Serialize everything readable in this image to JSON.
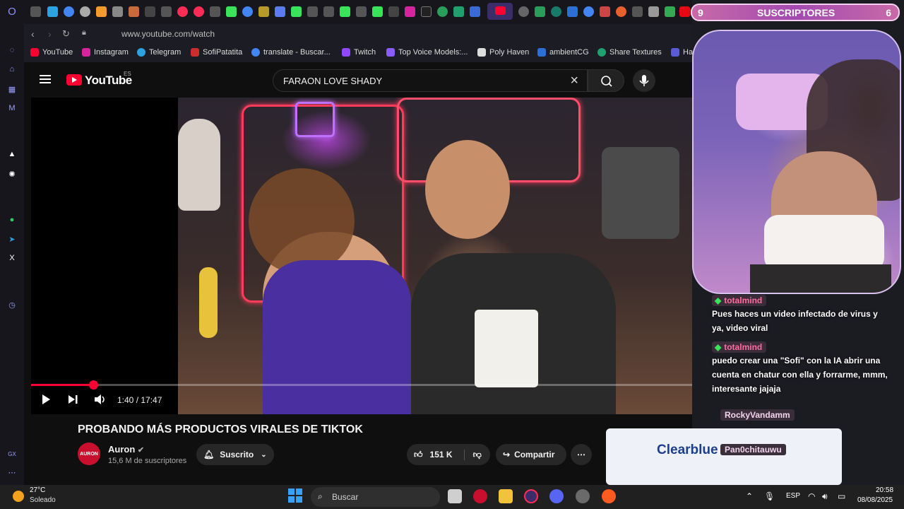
{
  "browser": {
    "url": "www.youtube.com/watch",
    "bookmarks": [
      {
        "label": "YouTube",
        "color": "#ff0033"
      },
      {
        "label": "Instagram",
        "color": "#d6249f"
      },
      {
        "label": "Telegram",
        "color": "#2aa3e0"
      },
      {
        "label": "SofiPatatita",
        "color": "#cc2d2d"
      },
      {
        "label": "translate - Buscar...",
        "color": "#4285f4"
      },
      {
        "label": "Twitch",
        "color": "#9146ff"
      },
      {
        "label": "Top Voice Models:...",
        "color": "#8a5cff"
      },
      {
        "label": "Poly Haven",
        "color": "#dddddd"
      },
      {
        "label": "ambientCG",
        "color": "#2c6fd6"
      },
      {
        "label": "Share Textures",
        "color": "#1fa06e"
      },
      {
        "label": "Har",
        "color": "#5b5bd6"
      }
    ]
  },
  "youtube": {
    "logo_text": "YouTube",
    "country_code": "ES",
    "search_value": "FARAON LOVE SHADY",
    "player": {
      "current_time": "1:40",
      "duration": "17:47",
      "time_label": "1:40 / 17:47",
      "progress_fraction": 0.094
    },
    "video_title": "PROBANDO MÁS PRODUCTOS VIRALES DE TIKTOK",
    "channel": {
      "name": "Auron",
      "avatar_text": "AURON",
      "subscribers": "15,6 M de suscriptores"
    },
    "subscribe_label": "Suscrito",
    "likes": "151 K",
    "share_label": "Compartir",
    "ad_brand": "Clearblue"
  },
  "overlay": {
    "subs_left": "9",
    "subs_title": "SUSCRIPTORES",
    "subs_right": "6",
    "chat": [
      {
        "user": "totalmind",
        "message": "Pues haces un video infectado de virus y ya, video viral"
      },
      {
        "user": "totalmind",
        "message": "puedo crear una \"Sofi\" con la IA abrir una cuenta en chatur con ella y forrarme, mmm, interesante jajaja"
      }
    ],
    "extra_users": [
      "RockyVandamm",
      "Pan0chitauwu"
    ]
  },
  "taskbar": {
    "temperature": "27°C",
    "weather": "Soleado",
    "search_placeholder": "Buscar",
    "language": "ESP",
    "time": "20:58",
    "date": "08/08/2025"
  }
}
